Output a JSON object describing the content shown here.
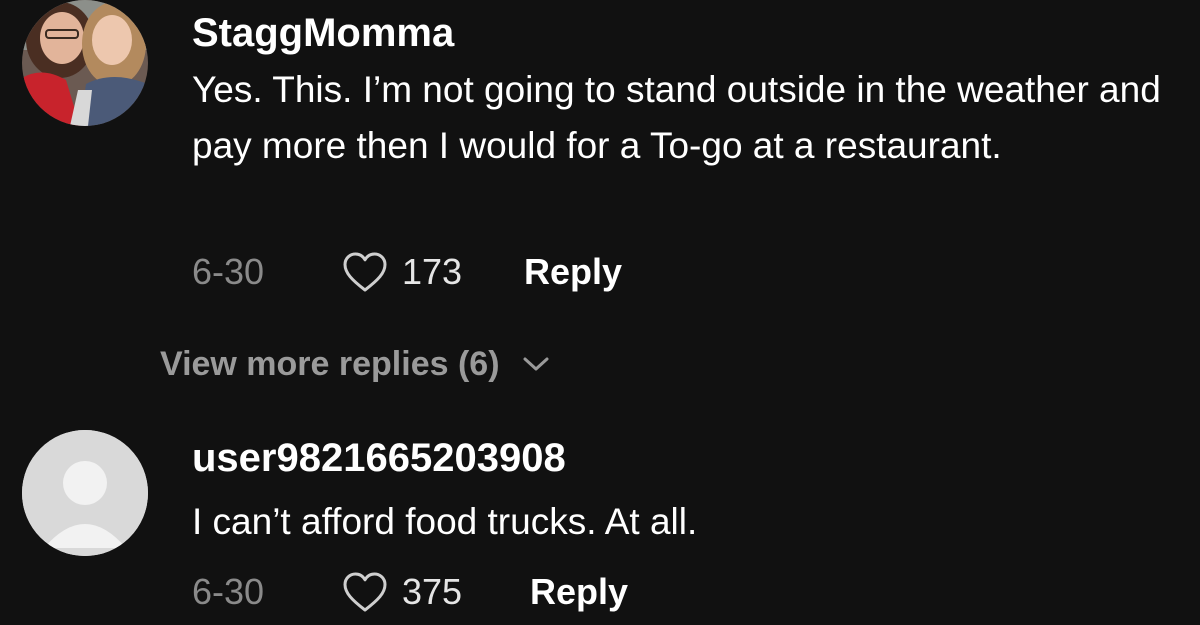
{
  "comments": [
    {
      "username": "StaggMomma",
      "avatar_icon": "photo-avatar-icon",
      "text": "Yes. This. I’m not going to stand outside in the weather and pay more then I would for a To-go at a restaurant.",
      "date": "6-30",
      "likes": "173",
      "reply_label": "Reply"
    },
    {
      "username": "user9821665203908",
      "avatar_icon": "default-user-icon",
      "text": "I can’t afford food trucks. At all.",
      "date": "6-30",
      "likes": "375",
      "reply_label": "Reply"
    }
  ],
  "view_more": {
    "label": "View more replies (6)",
    "icon": "chevron-down-icon"
  },
  "colors": {
    "background": "#111111",
    "primary_text": "#ffffff",
    "secondary_text": "#8a8a8a",
    "default_avatar_bg": "#d9d9d9"
  }
}
